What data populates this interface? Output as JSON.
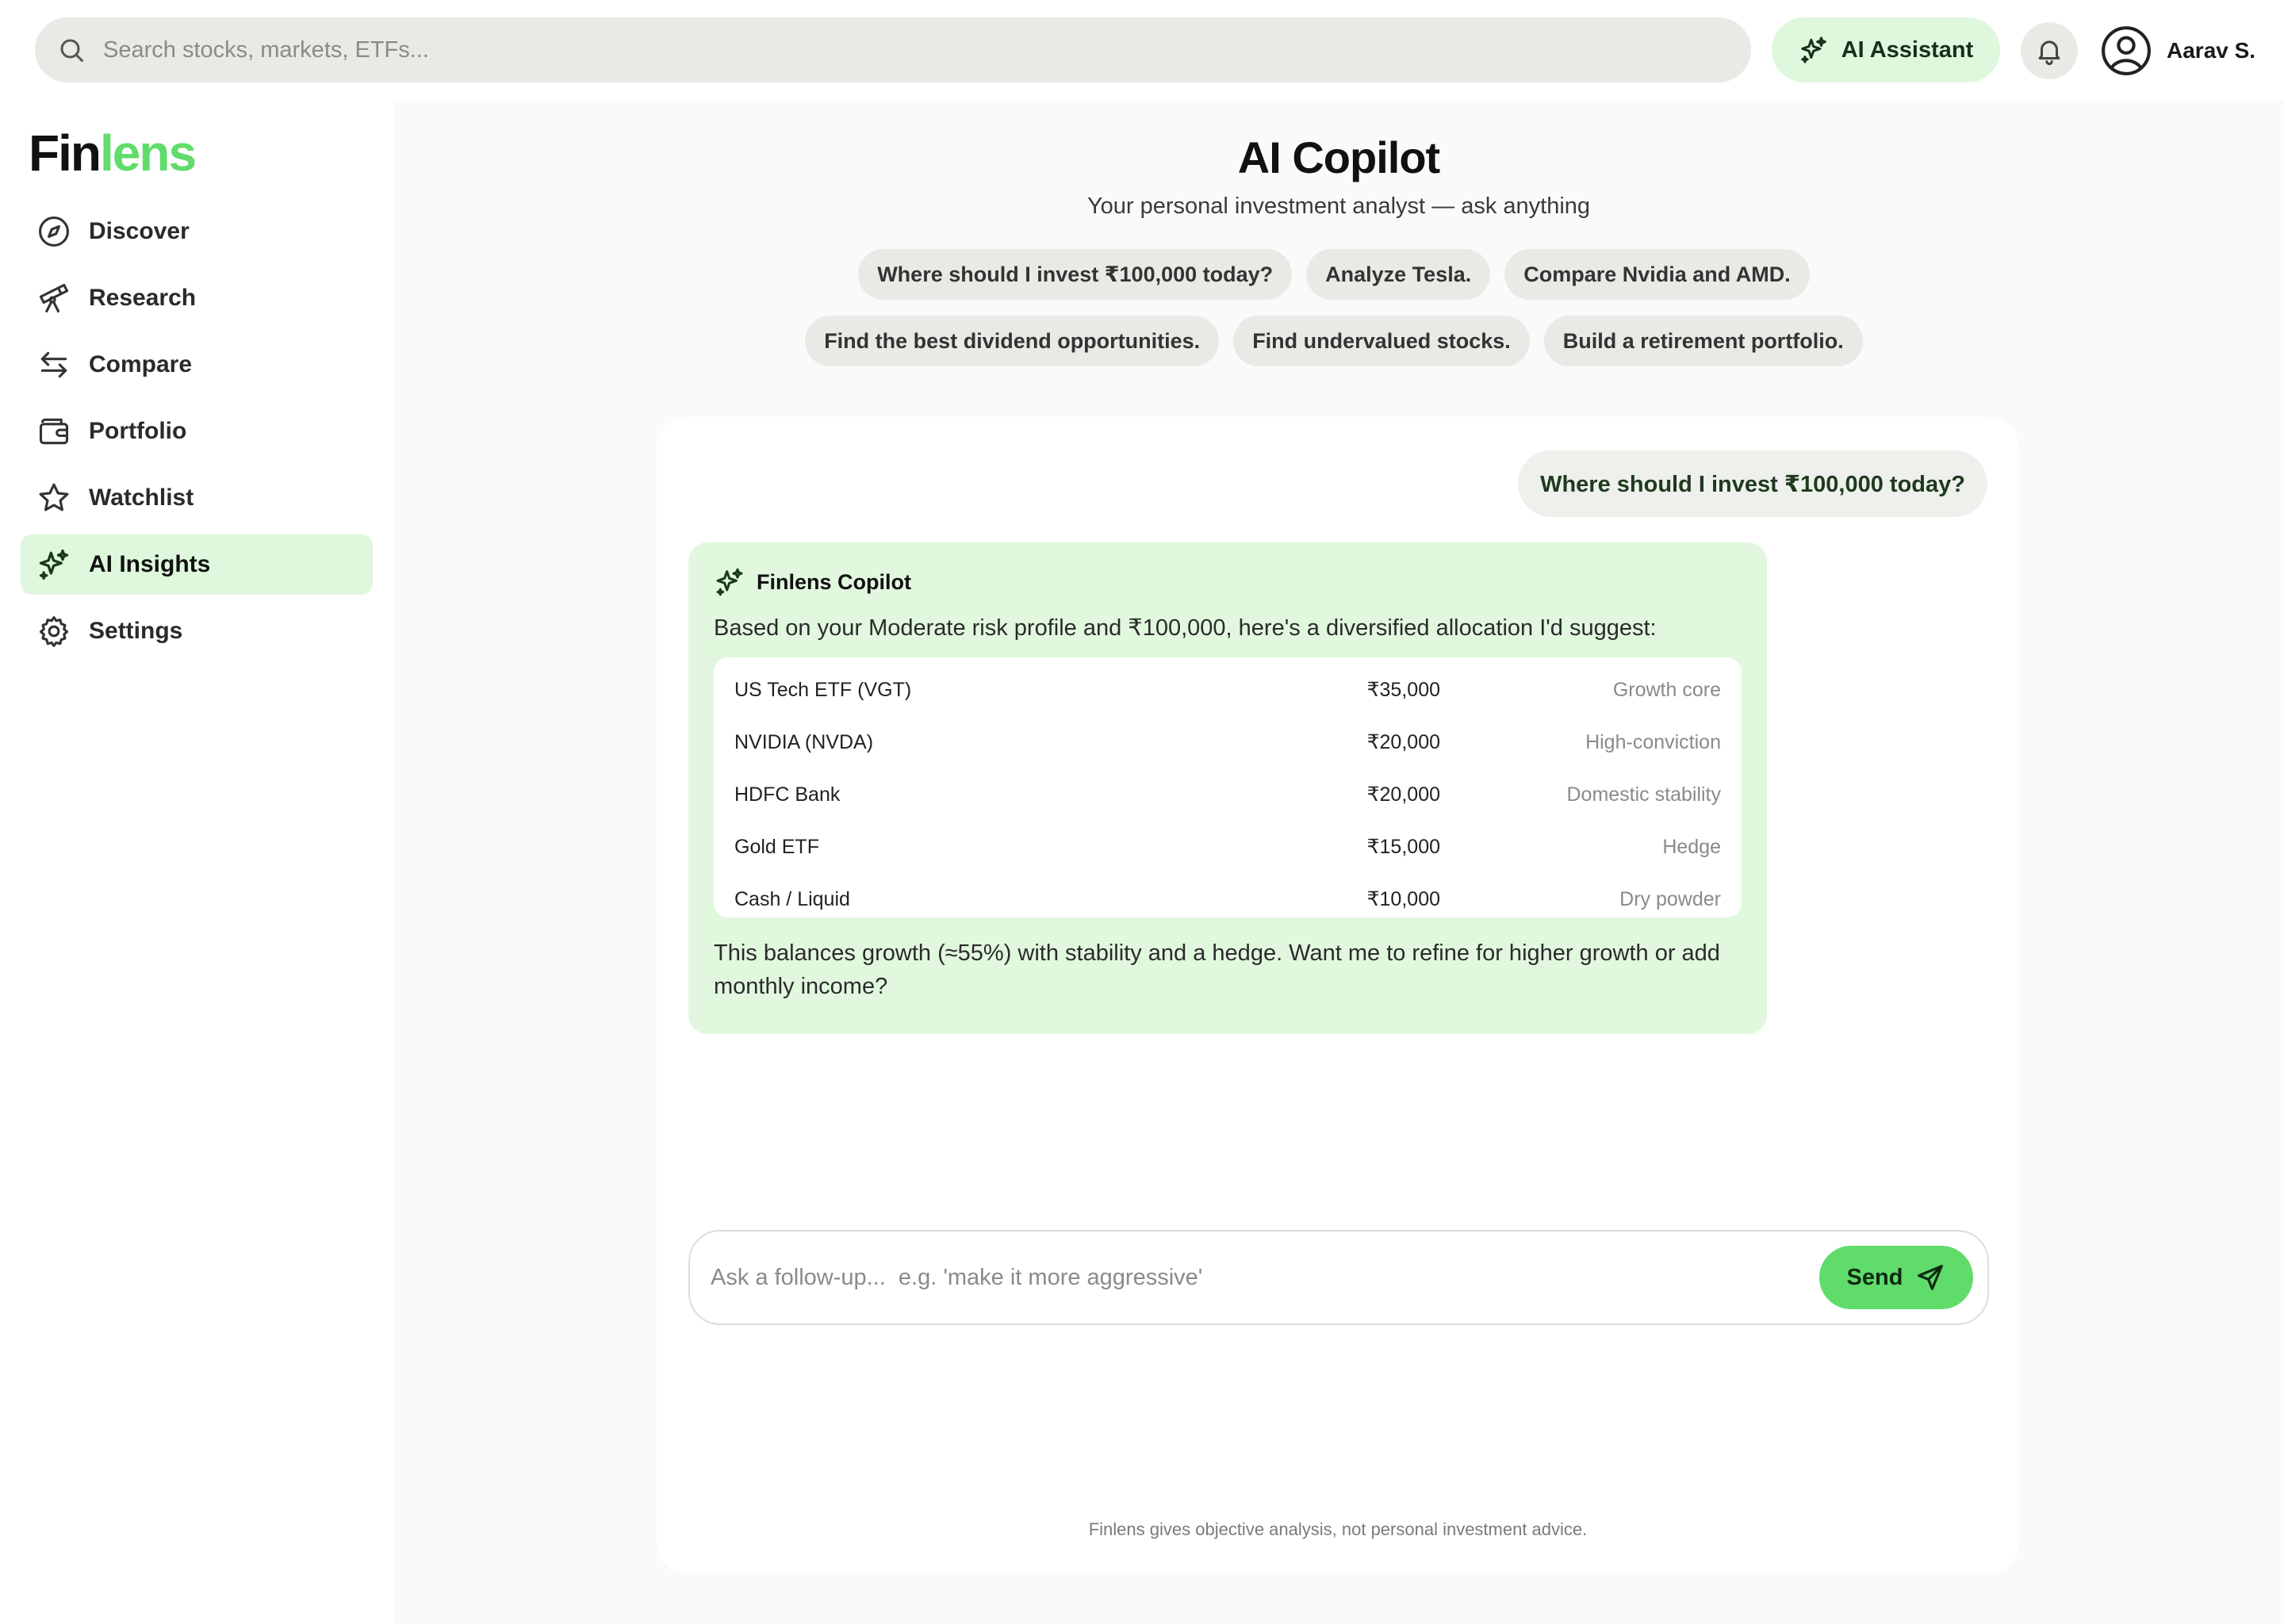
{
  "search": {
    "placeholder": "Search stocks, markets, ETFs..."
  },
  "header": {
    "ai_assistant_label": "AI Assistant",
    "user_name": "Aarav S."
  },
  "logo": {
    "part1": "Fin",
    "part2": "lens"
  },
  "sidebar": {
    "items": [
      {
        "label": "Discover",
        "icon": "compass-icon"
      },
      {
        "label": "Research",
        "icon": "telescope-icon"
      },
      {
        "label": "Compare",
        "icon": "swap-arrows-icon"
      },
      {
        "label": "Portfolio",
        "icon": "wallet-icon"
      },
      {
        "label": "Watchlist",
        "icon": "star-icon"
      },
      {
        "label": "AI Insights",
        "icon": "sparkles-icon",
        "active": true
      },
      {
        "label": "Settings",
        "icon": "gear-icon"
      }
    ]
  },
  "page": {
    "title": "AI Copilot",
    "subtitle": "Your personal investment analyst — ask anything"
  },
  "suggestions": [
    "Where should I invest ₹100,000 today?",
    "Analyze Tesla.",
    "Compare Nvidia and AMD.",
    "Find the best dividend opportunities.",
    "Find undervalued stocks.",
    "Build a retirement portfolio."
  ],
  "chat": {
    "user_message": "Where should I invest ₹100,000 today?",
    "bot_name": "Finlens Copilot",
    "bot_intro": "Based on your Moderate risk profile and ₹100,000, here's a diversified allocation I'd suggest:",
    "allocation": [
      {
        "name": "US Tech ETF (VGT)",
        "amount": "₹35,000",
        "role": "Growth core"
      },
      {
        "name": "NVIDIA (NVDA)",
        "amount": "₹20,000",
        "role": "High-conviction"
      },
      {
        "name": "HDFC Bank",
        "amount": "₹20,000",
        "role": "Domestic stability"
      },
      {
        "name": "Gold ETF",
        "amount": "₹15,000",
        "role": "Hedge"
      },
      {
        "name": "Cash / Liquid",
        "amount": "₹10,000",
        "role": "Dry powder"
      }
    ],
    "bot_outro": "This balances growth (≈55%) with stability and a hedge. Want me to refine for higher growth or add monthly income?"
  },
  "composer": {
    "placeholder": "Ask a follow-up...  e.g. 'make it more aggressive'",
    "send_label": "Send"
  },
  "disclaimer": "Finlens gives objective analysis, not personal investment advice.",
  "colors": {
    "accent": "#5fdc6a",
    "accent_soft": "#dff7dc",
    "chip_bg": "#e9eae5"
  }
}
